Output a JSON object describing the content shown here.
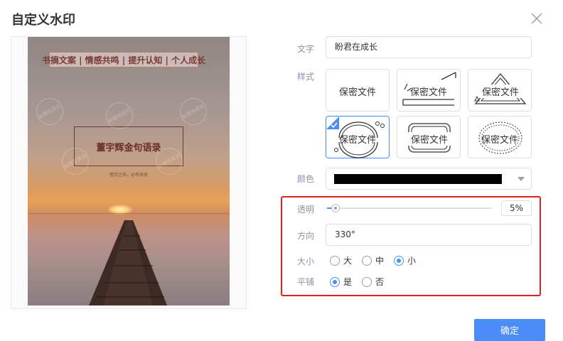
{
  "dialog": {
    "title": "自定义水印",
    "confirm_label": "确定"
  },
  "preview": {
    "heading": "书摘文案 | 情感共鸣 | 提升认知 | 个人成长",
    "book_title": "董宇辉金句语录",
    "book_subtitle": "看完之后，必有收获",
    "watermark_text": "盼君在成长"
  },
  "form": {
    "text_label": "文字",
    "text_value": "盼君在成长",
    "style_label": "样式",
    "styles": [
      {
        "label": "保密文件",
        "icon": "plain-rect-stamp-icon",
        "selected": false
      },
      {
        "label": "保密文件",
        "icon": "slanted-lines-stamp-icon",
        "selected": false
      },
      {
        "label": "保密文件",
        "icon": "triangle-stamp-icon",
        "selected": false
      },
      {
        "label": "保密文件",
        "icon": "circle-arc-stamp-icon",
        "selected": true
      },
      {
        "label": "保密文件",
        "icon": "rounded-frame-stamp-icon",
        "selected": false
      },
      {
        "label": "保密文件",
        "icon": "dotted-oval-stamp-icon",
        "selected": false
      }
    ],
    "color_label": "颜色",
    "color_value": "#000000",
    "opacity_label": "透明",
    "opacity_value": "5%",
    "opacity_fraction": 0.05,
    "direction_label": "方向",
    "direction_value": "330°",
    "size_label": "大小",
    "size_options": [
      "大",
      "中",
      "小"
    ],
    "size_selected": "小",
    "tile_label": "平铺",
    "tile_options": [
      "是",
      "否"
    ],
    "tile_selected": "是"
  },
  "colors": {
    "accent": "#4a8df8",
    "highlight_border": "#e3231b"
  }
}
